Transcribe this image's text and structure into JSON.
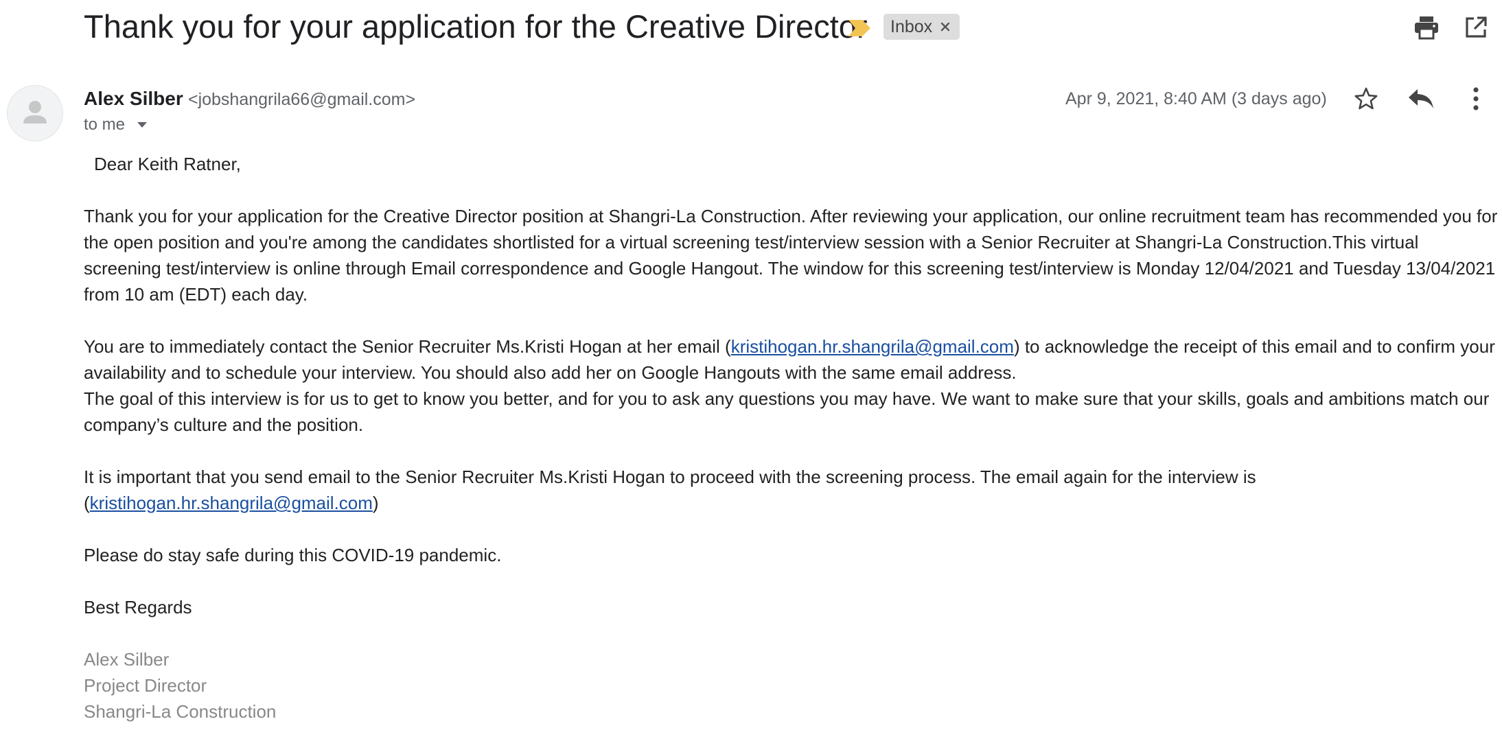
{
  "subject": "Thank you for your application for the Creative Director",
  "label_chip": "Inbox",
  "icons": {
    "importance": "importance-marker-icon",
    "label_close": "close-icon",
    "print": "print-icon",
    "open_new_window": "open-in-new-window-icon",
    "avatar": "person-icon",
    "recipient_details": "chevron-down-icon",
    "star": "star-icon",
    "reply": "reply-icon",
    "more": "more-vert-icon"
  },
  "colors": {
    "importance_marker": "#f2c454",
    "link": "#1a4fa0",
    "signature": "#888888",
    "label_chip_bg": "#dddddd"
  },
  "sender": {
    "name": "Alex Silber",
    "email": "<jobshangrila66@gmail.com>"
  },
  "to_text": "to me",
  "date": "Apr 9, 2021, 8:40 AM (3 days ago)",
  "body": {
    "greeting": "Dear Keith Ratner,",
    "p1": "Thank you for your application for the Creative Director  position at Shangri-La Construction. After reviewing your application, our online recruitment team has recommended you for the open position and you're among the candidates shortlisted for a virtual screening test/interview session with a Senior Recruiter at Shangri-La Construction.This virtual screening test/interview is online through Email correspondence and Google Hangout. The window for this screening test/interview is Monday 12/04/2021 and Tuesday 13/04/2021 from 10 am (EDT) each day.",
    "p2_before": "You are to immediately contact the Senior Recruiter Ms.Kristi Hogan at her email (",
    "p2_link": "kristihogan.hr.shangrila@gmail.com",
    "p2_after": ") to acknowledge the receipt of this email and to confirm your availability and to schedule your interview. You should also add her on  Google Hangouts with the same email address.",
    "p3": "The goal of this interview is for us to get to know you better, and for you to ask any questions you may have. We want to make sure that your skills, goals and ambitions match our company’s culture and the position.",
    "p4_before": "It is important that you send email to the Senior Recruiter Ms.Kristi Hogan to proceed with the screening process. The email again for the interview is (",
    "p4_link": "kristihogan.hr.shangrila@gmail.com",
    "p4_after": ")",
    "p5": "Please do stay safe during this COVID-19 pandemic.",
    "closing": "Best Regards"
  },
  "signature": {
    "name": "Alex Silber",
    "title": "Project Director",
    "company": "Shangri-La Construction"
  }
}
